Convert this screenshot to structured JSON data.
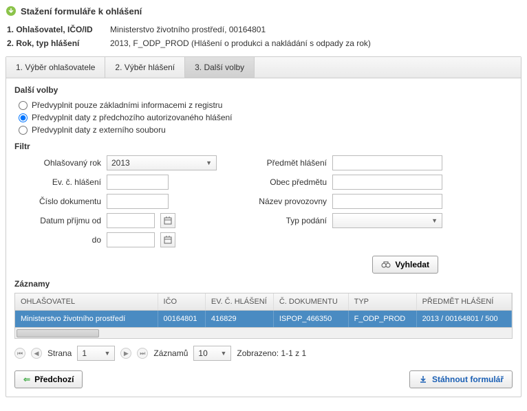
{
  "header": {
    "title": "Stažení formuláře k ohlášení"
  },
  "info": {
    "row1_label": "1. Ohlašovatel, IČO/ID",
    "row1_value": "Ministerstvo životního prostředí, 00164801",
    "row2_label": "2. Rok, typ hlášení",
    "row2_value": "2013, F_ODP_PROD (Hlášení o produkci a nakládání s odpady za rok)"
  },
  "tabs": {
    "t1": "1. Výběr ohlašovatele",
    "t2": "2. Výběr hlášení",
    "t3": "3. Další volby"
  },
  "section": {
    "title": "Další volby"
  },
  "radios": {
    "r1": "Předvyplnit pouze základními informacemi z registru",
    "r2": "Předvyplnit daty z předchozího autorizovaného hlášení",
    "r3": "Předvyplnit daty z externího souboru"
  },
  "filter": {
    "title": "Filtr",
    "l_year": "Ohlašovaný rok",
    "v_year": "2013",
    "l_evc": "Ev. č. hlášení",
    "l_doc": "Číslo dokumentu",
    "l_datefrom": "Datum příjmu od",
    "l_dateto": "do",
    "l_subject": "Předmět hlášení",
    "l_obec": "Obec předmětu",
    "l_provoz": "Název provozovny",
    "l_typ": "Typ podání",
    "btn_search": "Vyhledat"
  },
  "records": {
    "title": "Záznamy",
    "headers": {
      "h0": "OHLAŠOVATEL",
      "h1": "IČO",
      "h2": "EV. Č. HLÁŠENÍ",
      "h3": "Č. DOKUMENTU",
      "h4": "TYP",
      "h5": "PŘEDMĚT HLÁŠENÍ"
    },
    "row": {
      "c0": "Ministerstvo životního prostředí",
      "c1": "00164801",
      "c2": "416829",
      "c3": "ISPOP_466350",
      "c4": "F_ODP_PROD",
      "c5": "2013 / 00164801 / 500"
    }
  },
  "pager": {
    "l_page": "Strana",
    "v_page": "1",
    "l_records": "Záznamů",
    "v_records": "10",
    "shown": "Zobrazeno: 1-1 z 1"
  },
  "buttons": {
    "prev": "Předchozí",
    "download": "Stáhnout formulář"
  }
}
